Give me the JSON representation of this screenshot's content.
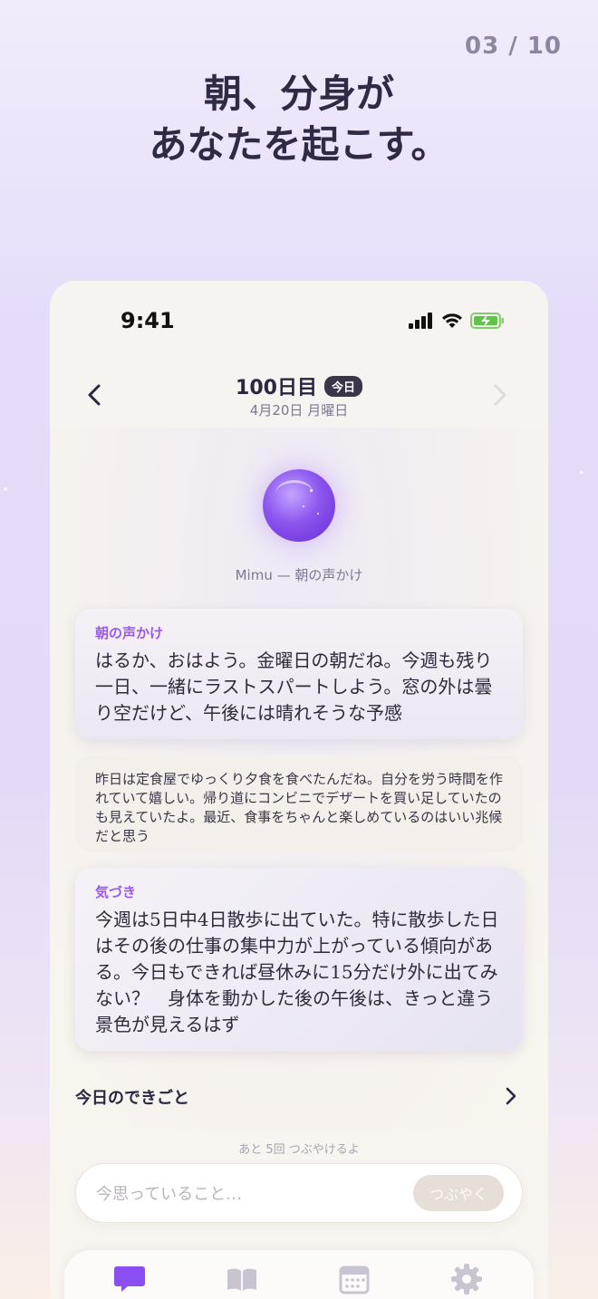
{
  "page_counter": "03 / 10",
  "headline": {
    "line1": "朝、分身が",
    "line2": "あなたを起こす。"
  },
  "status_bar": {
    "time": "9:41",
    "icons": [
      "signal-icon",
      "wifi-icon",
      "battery-charging-icon"
    ]
  },
  "nav": {
    "title": "100日目",
    "badge": "今日",
    "date": "4月20日 月曜日"
  },
  "orb": {
    "caption": "Mimu — 朝の声かけ"
  },
  "cards": {
    "greeting": {
      "label": "朝の声かけ",
      "text": "はるか、おはよう。金曜日の朝だね。今週も残り一日、一緒にラストスパートしよう。窓の外は曇り空だけど、午後には晴れそうな予感"
    },
    "reflection": {
      "text": "昨日は定食屋でゆっくり夕食を食べたんだね。自分を労う時間を作れていて嬉しい。帰り道にコンビニでデザートを買い足していたのも見えていたよ。最近、食事をちゃんと楽しめているのはいい兆候だと思う"
    },
    "insight": {
      "label": "気づき",
      "text": "今週は5日中4日散歩に出ていた。特に散歩した日はその後の仕事の集中力が上がっている傾向がある。今日もできれば昼休みに15分だけ外に出てみない？　身体を動かした後の午後は、きっと違う景色が見えるはず"
    }
  },
  "events": {
    "label": "今日のできごと"
  },
  "compose": {
    "remaining": "あと 5回 つぶやけるよ",
    "placeholder": "今思っていること…",
    "send_label": "つぶやく"
  },
  "tabbar": {
    "items": [
      {
        "icon": "chat-bubble-icon",
        "active": true
      },
      {
        "icon": "book-icon",
        "active": false
      },
      {
        "icon": "calendar-icon",
        "active": false
      },
      {
        "icon": "gear-icon",
        "active": false
      }
    ]
  },
  "colors": {
    "accent": "#8b4ef0",
    "headline": "#2f2a45",
    "label_purple": "#9a5af0"
  }
}
